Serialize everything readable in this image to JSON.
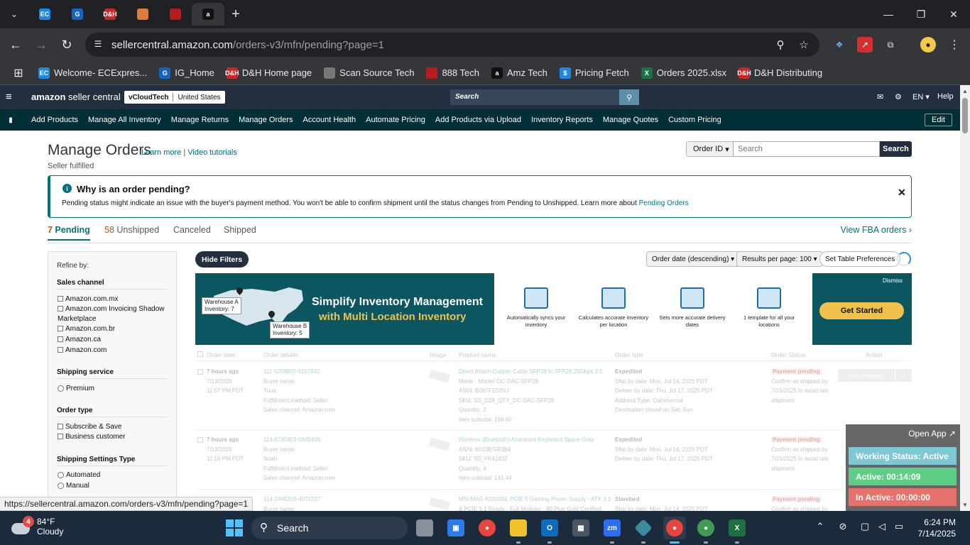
{
  "browser": {
    "tabs": [
      {
        "icon": "ec-icon",
        "letter": "EC",
        "color": "#1e88e5"
      },
      {
        "icon": "ig-icon",
        "letter": "G",
        "color": "#1565c0"
      },
      {
        "icon": "dh-icon",
        "letter": "D&H",
        "color": "#c62828"
      },
      {
        "icon": "box-icon",
        "letter": "",
        "color": "#e07b39"
      },
      {
        "icon": "888-icon",
        "letter": "",
        "color": "#b71c1c"
      },
      {
        "icon": "amazon-icon",
        "letter": "a",
        "color": "#111111"
      }
    ],
    "url_host": "sellercentral.amazon.com",
    "url_path": "/orders-v3/mfn/pending?page=1",
    "bookmarks": [
      {
        "label": "Welcome- ECExpres...",
        "icon": "ec-icon",
        "letter": "EC",
        "color": "#1e88e5"
      },
      {
        "label": "IG_Home",
        "icon": "ig-icon",
        "letter": "G",
        "color": "#1565c0"
      },
      {
        "label": "D&H Home page",
        "icon": "dh-icon",
        "letter": "D&H",
        "color": "#c62828"
      },
      {
        "label": "Scan Source Tech",
        "icon": "globe-icon",
        "letter": "",
        "color": "#777777"
      },
      {
        "label": "888 Tech",
        "icon": "888-icon",
        "letter": "",
        "color": "#b71c1c"
      },
      {
        "label": "Amz Tech",
        "icon": "amazon-icon",
        "letter": "a",
        "color": "#111111"
      },
      {
        "label": "Pricing Fetch",
        "icon": "dollar-icon",
        "letter": "$",
        "color": "#1e88e5"
      },
      {
        "label": "Orders 2025.xlsx",
        "icon": "excel-icon",
        "letter": "X",
        "color": "#1d7044"
      },
      {
        "label": "D&H Distributing",
        "icon": "dh-icon",
        "letter": "D&H",
        "color": "#c62828"
      }
    ],
    "status_url": "https://sellercentral.amazon.com/orders-v3/mfn/pending?page=1"
  },
  "amazon_header": {
    "logo_bold": "amazon",
    "logo_rest": " seller central",
    "account_name": "vCloudTech",
    "marketplace": "United States",
    "search_placeholder": "Search",
    "language": "EN",
    "help": "Help"
  },
  "nav": {
    "items": [
      "Add Products",
      "Manage All Inventory",
      "Manage Returns",
      "Manage Orders",
      "Account Health",
      "Automate Pricing",
      "Add Products via Upload",
      "Inventory Reports",
      "Manage Quotes",
      "Custom Pricing"
    ],
    "edit": "Edit"
  },
  "page": {
    "title": "Manage Orders",
    "learn_more": "Learn more",
    "separator": " | ",
    "video_tutorials": "Video tutorials",
    "subtitle": "Seller fulfilled",
    "search_type": "Order ID",
    "search_placeholder": "Search",
    "search_button": "Search"
  },
  "alert": {
    "title": "Why is an order pending?",
    "body": "Pending status might indicate an issue with the buyer's payment method. You won't be able to confirm shipment until the status changes from Pending to Unshipped. Learn more about ",
    "link": "Pending Orders"
  },
  "order_tabs": [
    {
      "count": "7",
      "label": " Pending",
      "active": true
    },
    {
      "count": "58",
      "label": " Unshipped",
      "active": false
    },
    {
      "count": "",
      "label": "Canceled",
      "active": false
    },
    {
      "count": "",
      "label": "Shipped",
      "active": false
    }
  ],
  "view_fba": "View FBA orders ›",
  "filters": {
    "refine_by": "Refine by:",
    "sales_channel_title": "Sales channel",
    "sales_channels": [
      "Amazon.com.mx",
      "Amazon.com Invoicing Shadow Marketplace",
      "Amazon.com.br",
      "Amazon.ca",
      "Amazon.com"
    ],
    "shipping_service_title": "Shipping service",
    "shipping_services": [
      "Premium"
    ],
    "order_type_title": "Order type",
    "order_types": [
      "Subscribe & Save",
      "Business customer"
    ],
    "shipping_settings_title": "Shipping Settings Type",
    "shipping_settings": [
      "Automated",
      "Manual"
    ]
  },
  "controls": {
    "hide_filters": "Hide Filters",
    "sort": "Order date (descending)",
    "per_page": "Results per page: 100",
    "table_prefs": "Set Table Preferences"
  },
  "banner": {
    "warehouse_a": "Warehouse A\nInventory: 7",
    "warehouse_b": "Warehouse B\nInventory: 5",
    "headline": "Simplify Inventory Management",
    "subheadline": "with Multi Location Inventory",
    "features": [
      {
        "icon": "barcode-icon",
        "text": "Automatically syncs your inventory"
      },
      {
        "icon": "building-icon",
        "text": "Calculates accurate inventory per location"
      },
      {
        "icon": "calendar-icon",
        "text": "Sets more accurate delivery dates"
      },
      {
        "icon": "box-icon",
        "text": "1 template for all your locations"
      }
    ],
    "dismiss": "Dismiss",
    "cta": "Get Started"
  },
  "table": {
    "headers": [
      "Order date",
      "Order details",
      "Image",
      "Product name",
      "Order type",
      "Order Status",
      "Action"
    ],
    "rows": [
      {
        "date": [
          "7 hours ago",
          "7/13/2025",
          "11:57 PM PDT"
        ],
        "details": [
          "111-5058800-9157842",
          "Buyer name:",
          "Tuna",
          "Fulfillment method: Seller",
          "Sales channel: Amazon.com"
        ],
        "product": [
          "Direct Attach Copper Cable SFP28 to SFP28 25Gbps 0.5",
          "Meter - Model: DC-DAC-SFP28",
          "ASIN: B087F1D3VJ",
          "SKU: SS_D28_QTY_DC-DAC-SFP28",
          "Quantity: 2",
          "Item subtotal: 169.60"
        ],
        "order_type": [
          "Expedited",
          "Ship by date: Mon, Jul 14, 2025 PDT",
          "Deliver by date: Thu, Jul 17, 2025 PDT",
          "Address Type: Commercial",
          "Destination closed on Sat, Sun"
        ],
        "status": "Payment pending",
        "status_note": [
          "Confirm as shipped by",
          "7/15/2025 to avoid late",
          "shipment"
        ],
        "action": "Buy shipping"
      },
      {
        "date": [
          "7 hours ago",
          "7/13/2025",
          "11:16 PM PDT"
        ],
        "details": [
          "114-8785903-0845406",
          "Buyer name:",
          "Noah",
          "Fulfillment method: Seller",
          "Sales channel: Amazon.com"
        ],
        "product": [
          "Wireless (Bluetooth) Aluminum Keyboard Space Gray",
          "ASIN: B019EGR3B4",
          "SKU: SS_FK4183Z",
          "Quantity: 4",
          "Item subtotal: 141.44"
        ],
        "order_type": [
          "Expedited",
          "Ship by date: Mon, Jul 14, 2025 PDT",
          "Deliver by date: Thu, Jul 17, 2025 PDT"
        ],
        "status": "Payment pending",
        "status_note": [
          "Confirm as shipped by",
          "7/15/2025 to avoid late",
          "shipment"
        ],
        "action": ""
      },
      {
        "date": [
          "",
          "",
          ""
        ],
        "details": [
          "114-2465259-4072227",
          "Buyer name:",
          "",
          "",
          ""
        ],
        "product": [
          "MSI MAG A1000GL PCIE 5 Gaming Power Supply - ATX 3.1",
          "& PCIE 5.1 Ready - Full Modular - 80 Plus Gold Certified"
        ],
        "order_type": [
          "Standard",
          "Ship by date: Mon, Jul 14, 2025 PDT"
        ],
        "status": "Payment pending",
        "status_note": [
          "Confirm as shipped by"
        ],
        "action": ""
      }
    ]
  },
  "tracker": {
    "open_app": "Open App ↗",
    "working": "Working Status: Active",
    "active": "Active: 00:14:09",
    "inactive": "In Active: 00:00:00"
  },
  "taskbar": {
    "temp": "84°F",
    "condition": "Cloudy",
    "badge": "4",
    "search": "Search",
    "time": "6:24 PM",
    "date": "7/14/2025"
  }
}
